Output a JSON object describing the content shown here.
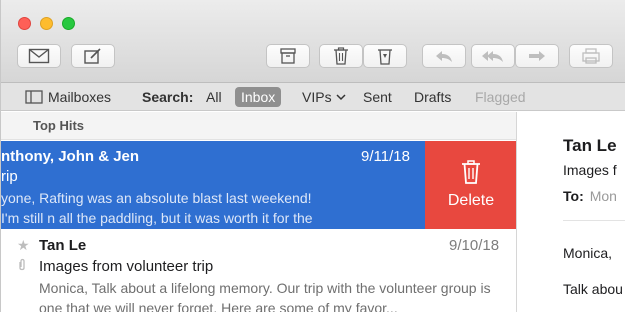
{
  "toolbar": {
    "icons": [
      "compose-envelope-icon",
      "new-message-icon",
      "archive-icon",
      "trash-icon",
      "junk-icon",
      "reply-icon",
      "reply-all-icon",
      "forward-icon",
      "print-icon"
    ]
  },
  "favorites_bar": {
    "mailboxes": "Mailboxes",
    "search_label": "Search:",
    "all": "All",
    "inbox": "Inbox",
    "vips": "VIPs",
    "sent": "Sent",
    "drafts": "Drafts",
    "flagged": "Flagged"
  },
  "message_list": {
    "section": "Top Hits",
    "rows": [
      {
        "sender": "nthony, John & Jen",
        "date": "9/11/18",
        "subject": "rip",
        "preview": "yone, Rafting was an absolute blast last weekend! I'm still n all the paddling, but it was worth it for the rush. Here are",
        "swipe_action": "Delete"
      },
      {
        "sender": "Tan Le",
        "date": "9/10/18",
        "subject": "Images from volunteer trip",
        "preview": "Monica, Talk about a lifelong memory. Our trip with the volunteer group is one that we will never forget. Here are some of my favor..."
      }
    ]
  },
  "message_view": {
    "from": "Tan Le",
    "subject": "Images f",
    "to_label": "To:",
    "to_value": "Mon",
    "body_line1": "Monica,",
    "body_line2": "Talk abou"
  },
  "colors": {
    "selection_blue": "#2f6fd1",
    "delete_red": "#e8483f",
    "inbox_pill": "#8f8f8f"
  }
}
